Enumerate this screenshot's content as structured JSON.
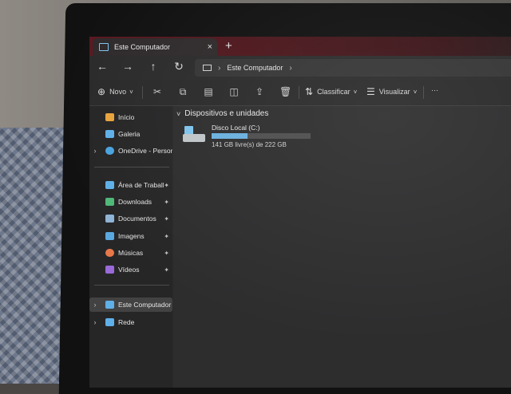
{
  "window": {
    "tab_title": "Este Computador",
    "tab_close": "×",
    "new_tab": "+"
  },
  "nav": {
    "back": "←",
    "forward": "→",
    "up": "↑",
    "refresh": "↻",
    "breadcrumb": "Este Computador",
    "crumb_sep": "›"
  },
  "toolbar": {
    "new_label": "Novo",
    "sort_label": "Classificar",
    "view_label": "Visualizar",
    "more_label": "···"
  },
  "sidebar": {
    "items": [
      {
        "label": "Início",
        "icon": "home-icon",
        "color": "#e8a33c"
      },
      {
        "label": "Galeria",
        "icon": "gallery-icon",
        "color": "#5fb0e8"
      },
      {
        "label": "OneDrive - Persona",
        "icon": "cloud-icon",
        "color": "#4aa3df"
      },
      {
        "label": "Área de Trabalho",
        "icon": "desktop-icon",
        "color": "#5fb0e8"
      },
      {
        "label": "Downloads",
        "icon": "download-icon",
        "color": "#4fb878"
      },
      {
        "label": "Documentos",
        "icon": "documents-icon",
        "color": "#8fb4d6"
      },
      {
        "label": "Imagens",
        "icon": "pictures-icon",
        "color": "#5aa8e0"
      },
      {
        "label": "Músicas",
        "icon": "music-icon",
        "color": "#e8784a"
      },
      {
        "label": "Vídeos",
        "icon": "videos-icon",
        "color": "#9a6ad8"
      },
      {
        "label": "Este Computador",
        "icon": "computer-icon",
        "color": "#5fb0e8"
      },
      {
        "label": "Rede",
        "icon": "network-icon",
        "color": "#5fb0e8"
      }
    ]
  },
  "content": {
    "group_header": "Dispositivos e unidades",
    "drive": {
      "name": "Disco Local (C:)",
      "free_text": "141 GB livre(s) de 222 GB",
      "used_fraction": 0.36,
      "bar_color": "#6ab0de"
    }
  }
}
